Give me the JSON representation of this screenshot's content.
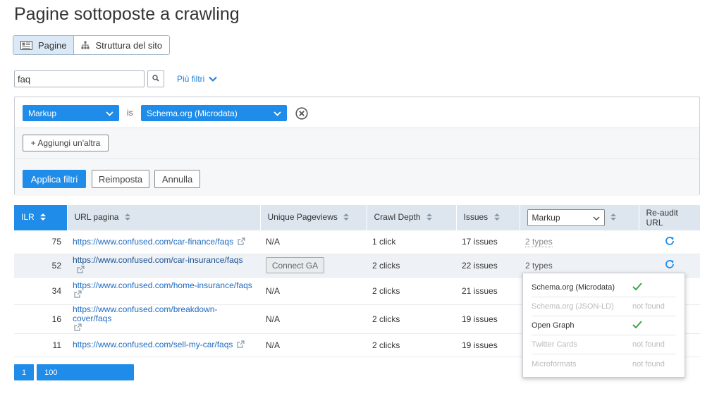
{
  "page_title": "Pagine sottoposte a crawling",
  "view_toggle": {
    "pages_label": "Pagine",
    "structure_label": "Struttura del sito"
  },
  "search": {
    "value": "faq"
  },
  "more_filters_label": "Più filtri",
  "filter": {
    "field_label": "Markup",
    "operator_label": "is",
    "value_label": "Schema.org (Microdata)",
    "add_label": "+ Aggiungi un'altra",
    "apply_label": "Applica filtri",
    "reset_label": "Reimposta",
    "cancel_label": "Annulla"
  },
  "table": {
    "headers": {
      "ilr": "ILR",
      "url": "URL pagina",
      "pageviews": "Unique Pageviews",
      "depth": "Crawl Depth",
      "issues": "Issues",
      "markup_select": "Markup",
      "reaudit": "Re-audit URL"
    },
    "rows": [
      {
        "ilr": "75",
        "url": "https://www.confused.com/car-finance/faqs",
        "pageviews": "N/A",
        "depth": "1 click",
        "issues": "17 issues",
        "markup": "2 types"
      },
      {
        "ilr": "52",
        "url": "https://www.confused.com/car-insurance/faqs",
        "pageviews_button": "Connect GA",
        "depth": "2 clicks",
        "issues": "22 issues",
        "markup": "2 types"
      },
      {
        "ilr": "34",
        "url": "https://www.confused.com/home-insurance/faqs",
        "pageviews": "N/A",
        "depth": "2 clicks",
        "issues": "21 issues"
      },
      {
        "ilr": "16",
        "url": "https://www.confused.com/breakdown-cover/faqs",
        "pageviews": "N/A",
        "depth": "2 clicks",
        "issues": "19 issues"
      },
      {
        "ilr": "11",
        "url": "https://www.confused.com/sell-my-car/faqs",
        "pageviews": "N/A",
        "depth": "2 clicks",
        "issues": "19 issues"
      }
    ]
  },
  "markup_popup": [
    {
      "name": "Schema.org (Microdata)",
      "found": true,
      "status": ""
    },
    {
      "name": "Schema.org (JSON-LD)",
      "found": false,
      "status": "not found"
    },
    {
      "name": "Open Graph",
      "found": true,
      "status": ""
    },
    {
      "name": "Twitter Cards",
      "found": false,
      "status": "not found"
    },
    {
      "name": "Microformats",
      "found": false,
      "status": "not found"
    }
  ],
  "pagination": {
    "page": "1",
    "per_page": "100"
  },
  "colors": {
    "accent": "#1e8ce8",
    "link": "#1e6bc0",
    "check": "#3aa64a",
    "header_bg": "#dde6ef"
  },
  "icons": {
    "pages": "pages-icon",
    "structure": "sitemap-icon",
    "search": "search-icon",
    "chevron": "chevron-down-icon",
    "clear": "clear-circle-icon",
    "sort": "sort-icon",
    "external": "external-link-icon",
    "reaudit": "refresh-icon",
    "check": "check-icon"
  }
}
